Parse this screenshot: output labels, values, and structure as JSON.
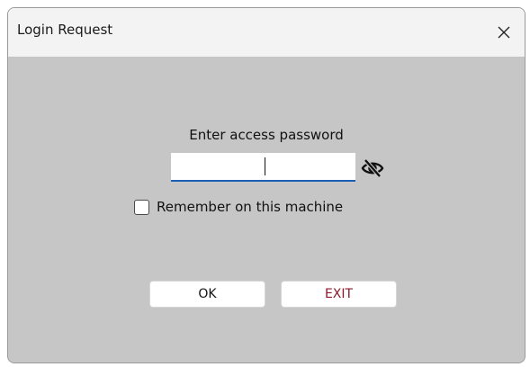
{
  "window": {
    "title": "Login Request"
  },
  "form": {
    "prompt": "Enter access password",
    "password_value": "",
    "password_placeholder": "",
    "toggle_icon": "eye-slash-icon",
    "remember_label": "Remember on this machine",
    "remember_checked": false
  },
  "buttons": {
    "ok_label": "OK",
    "exit_label": "EXIT"
  },
  "colors": {
    "input_focus_underline": "#1a5fb4",
    "exit_text": "#8b1a2b",
    "content_background": "#c6c6c6"
  }
}
